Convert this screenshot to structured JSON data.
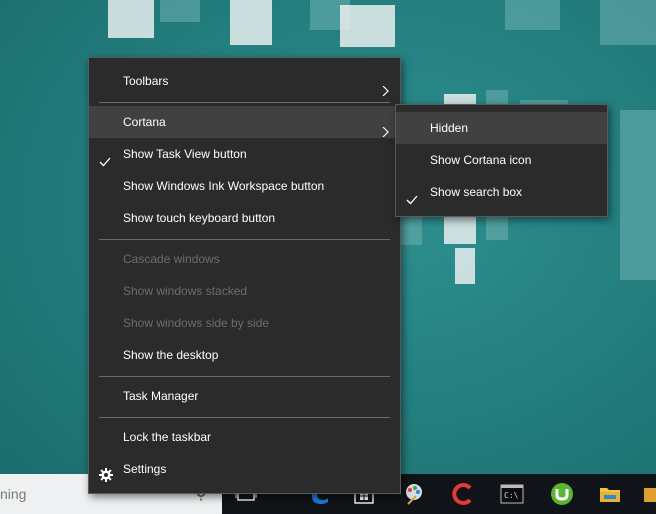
{
  "search": {
    "text": "ning"
  },
  "context_menu": {
    "items": [
      {
        "label": "Toolbars"
      },
      {
        "label": "Cortana"
      },
      {
        "label": "Show Task View button"
      },
      {
        "label": "Show Windows Ink Workspace button"
      },
      {
        "label": "Show touch keyboard button"
      },
      {
        "label": "Cascade windows"
      },
      {
        "label": "Show windows stacked"
      },
      {
        "label": "Show windows side by side"
      },
      {
        "label": "Show the desktop"
      },
      {
        "label": "Task Manager"
      },
      {
        "label": "Lock the taskbar"
      },
      {
        "label": "Settings"
      }
    ]
  },
  "cortana_submenu": {
    "items": [
      {
        "label": "Hidden"
      },
      {
        "label": "Show Cortana icon"
      },
      {
        "label": "Show search box"
      }
    ]
  },
  "taskbar_icons": [
    "task-view-icon",
    "edge-icon",
    "store-icon",
    "paint-icon",
    "ccleaner-icon",
    "command-prompt-icon",
    "utorrent-icon",
    "file-explorer-icon",
    "app-icon"
  ],
  "colors": {
    "menu_bg": "#2b2b2b",
    "hover_bg": "#414141",
    "disabled_text": "#6d6d6d",
    "wallpaper": "#227c7c",
    "taskbar": "#101418"
  }
}
